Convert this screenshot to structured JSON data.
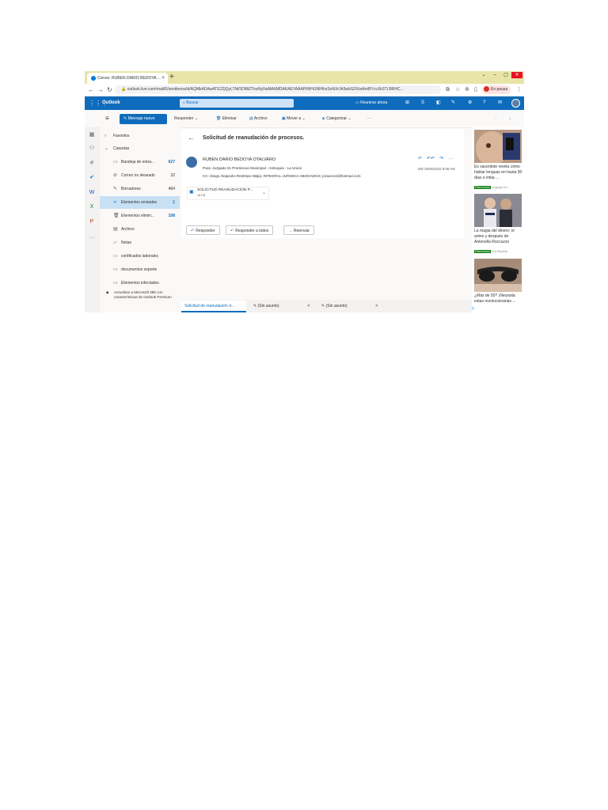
{
  "browser": {
    "tab_title": "Correo: RUBEN DARIO BEDOYA ...",
    "tab_close": "×",
    "new_tab": "+",
    "url": "outlook.live.com/mail/0/sentitems/id/AQMkADAwATE2ZjQyLTNiODMtZTcwNy0wMAItMDAKAEYAAAPtWHUNIHhzSnNXr343wbSZtXwAmBYcvXb3TLBRHC...",
    "profile_label": "En pausa",
    "window_controls": [
      "⌄",
      "–",
      "▢",
      "✕"
    ]
  },
  "outlook": {
    "app_name": "Outlook",
    "search_placeholder": "Buscar",
    "meet_now": "Reunirse ahora",
    "new_message": "Mensaje nuevo",
    "toolbar": {
      "reply": "Responder",
      "delete": "Eliminar",
      "archive": "Archivo",
      "move_to": "Mover a",
      "categorize": "Categorizar",
      "more": "···"
    },
    "folders": {
      "favorites": "Favoritos",
      "folders_header": "Carpetas",
      "items": [
        {
          "label": "Bandeja de entra...",
          "count": "627"
        },
        {
          "label": "Correo no deseado",
          "count": "32"
        },
        {
          "label": "Borradores",
          "count": "484"
        },
        {
          "label": "Elementos enviados",
          "count": "1"
        },
        {
          "label": "Elementos elimin...",
          "count": "108"
        },
        {
          "label": "Archivo",
          "count": ""
        },
        {
          "label": "Notas",
          "count": ""
        },
        {
          "label": "certificados laborales",
          "count": ""
        },
        {
          "label": "documentos soporte",
          "count": ""
        },
        {
          "label": "Elementos infectados",
          "count": ""
        }
      ],
      "upgrade": "Actualizar a Microsoft 365 con características de Outlook Premium"
    },
    "message": {
      "subject": "Solicitud de reanudación de procesos.",
      "sender": "RUBEN DARIO BEDOYA OTALVARO",
      "to": "Para: Juzgado 01 Promiscuo Municipal - Antioquia - La Union",
      "cc": "CC: Diego Alejandro Restrepo Mejia; INTEGRAL JURIDICA ABOGADOS; joracecor@hotmail.com",
      "date": "Mié 25/05/2022 8:08 AM",
      "attachment_name": "SOLICITUD REANUDACION P...",
      "attachment_size": "18 KB",
      "actions": [
        "Responder",
        "Responder a todos",
        "Reenviar"
      ]
    },
    "bottom_tabs": [
      {
        "label": "Solicitud de reanudación d..."
      },
      {
        "label": "(Sin asunto)"
      },
      {
        "label": "(Sin asunto)"
      }
    ],
    "ads": [
      {
        "text": "Es sacerdote revela cómo hablar lenguas en hasta 90 días e imita ...",
        "tag": "Patrocinado",
        "source": "Lenguaje De ..."
      },
      {
        "text": "La magia del dinero: el antes y después de Antonella Roccuzzo",
        "tag": "Patrocinado",
        "source": "Fan Republic"
      },
      {
        "text": "¿Más de 50? ¡Necesita estas revolucionarias ...",
        "tag": "",
        "source": ""
      }
    ]
  },
  "colors": {
    "brand": "#0f6cbd",
    "selected_folder": "#c7e0f4",
    "tab_bar": "#e8e4a8"
  }
}
